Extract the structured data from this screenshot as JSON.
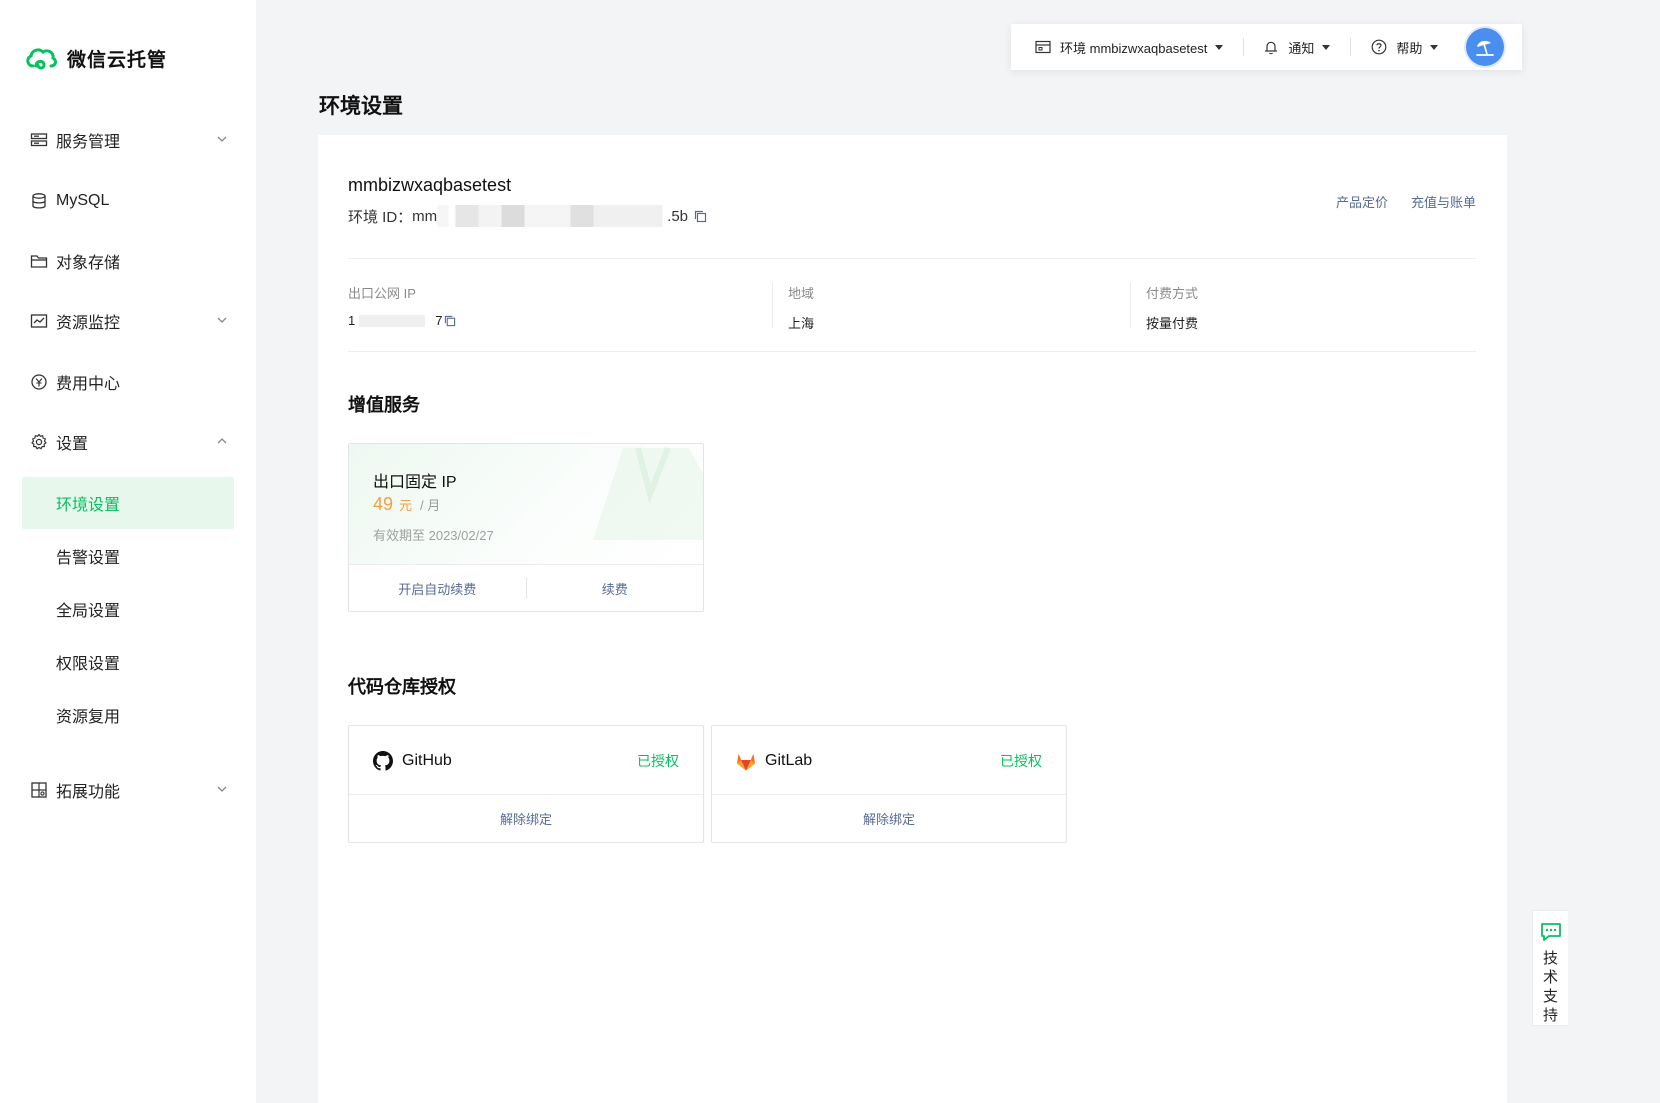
{
  "app": {
    "brand": "微信云托管",
    "accent": "#07c160",
    "link_color": "#576b95"
  },
  "sidebar": {
    "items": [
      {
        "label": "服务管理",
        "icon": "server-icon",
        "chevron": "down"
      },
      {
        "label": "MySQL",
        "icon": "database-icon"
      },
      {
        "label": "对象存储",
        "icon": "folder-icon"
      },
      {
        "label": "资源监控",
        "icon": "monitor-icon",
        "chevron": "down"
      },
      {
        "label": "费用中心",
        "icon": "yen-icon"
      },
      {
        "label": "设置",
        "icon": "gear-icon",
        "chevron": "up"
      }
    ],
    "settings_sub": [
      {
        "label": "环境设置",
        "active": true
      },
      {
        "label": "告警设置"
      },
      {
        "label": "全局设置"
      },
      {
        "label": "权限设置"
      },
      {
        "label": "资源复用"
      }
    ],
    "extension": {
      "label": "拓展功能",
      "icon": "puzzle-icon",
      "chevron": "down"
    }
  },
  "topbar": {
    "env_label": "环境 mmbizwxaqbasetest",
    "notify_label": "通知",
    "help_label": "帮助"
  },
  "page": {
    "title": "环境设置"
  },
  "env": {
    "name": "mmbizwxaqbasetest",
    "id_label": "环境 ID：",
    "id_prefix": "mm",
    "id_suffix": ".5b",
    "links": [
      "产品定价",
      "充值与账单"
    ]
  },
  "info": {
    "ip_label": "出口公网 IP",
    "ip_prefix": "1",
    "ip_suffix": "7",
    "region_label": "地域",
    "region_value": "上海",
    "billing_label": "付费方式",
    "billing_value": "按量付费"
  },
  "value_added": {
    "section_title": "增值服务",
    "card_title": "出口固定 IP",
    "price": "49",
    "price_unit": "元",
    "price_period": "/ 月",
    "expiry": "有效期至 2023/02/27",
    "action_auto_renew": "开启自动续费",
    "action_renew": "续费"
  },
  "repos": {
    "section_title": "代码仓库授权",
    "items": [
      {
        "name": "GitHub",
        "status": "已授权",
        "action": "解除绑定",
        "icon": "github-icon"
      },
      {
        "name": "GitLab",
        "status": "已授权",
        "action": "解除绑定",
        "icon": "gitlab-icon"
      }
    ]
  },
  "support": {
    "label": "技术支持"
  }
}
